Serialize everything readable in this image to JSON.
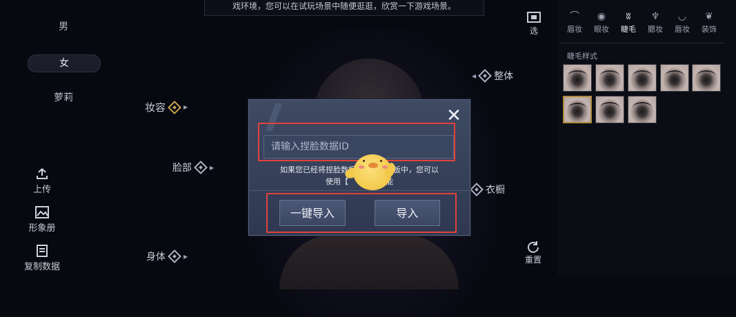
{
  "top_notice": "戏环境，您可以在试玩场景中随便逛逛，欣赏一下游戏场景。",
  "gender_options": [
    {
      "label": "男"
    },
    {
      "label": "女"
    },
    {
      "label": "萝莉"
    }
  ],
  "selected_gender": "女",
  "tools": {
    "upload": "上传",
    "album": "形象册",
    "copy_data": "复制数据"
  },
  "markers": {
    "makeup": "妆容",
    "face": "脸部",
    "body": "身体",
    "overall": "整体",
    "wardrobe": "衣橱"
  },
  "side_buttons": {
    "select": "选",
    "reset": "重置"
  },
  "right_panel": {
    "tabs": [
      {
        "label": "眉妆",
        "icon": "brow-icon"
      },
      {
        "label": "眼妆",
        "icon": "eye-icon"
      },
      {
        "label": "睫毛",
        "icon": "lash-icon"
      },
      {
        "label": "腮妆",
        "icon": "blush-brush-icon"
      },
      {
        "label": "唇妆",
        "icon": "lips-icon"
      },
      {
        "label": "装饰",
        "icon": "ornament-icon"
      }
    ],
    "active_tab": "睫毛",
    "section_title": "睫毛样式",
    "swatch_count": 8,
    "selected_swatch": 6
  },
  "modal": {
    "input_placeholder": "请输入捏脸数据ID",
    "hint_line1": "如果您已经将捏脸数据",
    "hint_line1_tail": "板中，您可以",
    "hint_line2": "使用【",
    "hint_line2_tail": "能",
    "button_one_click": "一键导入",
    "button_import": "导入"
  },
  "colors": {
    "highlight_red": "#e1423c",
    "modal_blue": "#3f4a63",
    "selected_gold": "#b08a3e"
  }
}
